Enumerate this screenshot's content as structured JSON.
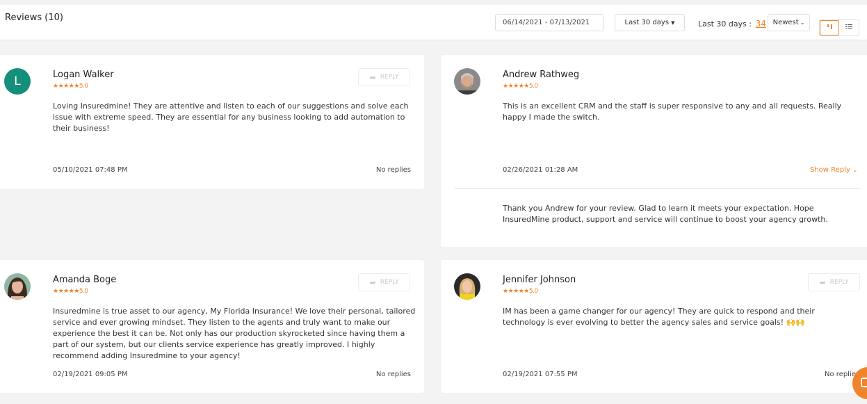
{
  "header": {
    "title": "Reviews (10)",
    "date_range": "06/14/2021 - 07/13/2021",
    "period_dropdown": "Last 30 days",
    "count_label": "Last 30 days :",
    "count_value": "34",
    "sort_dropdown": "Newest"
  },
  "colors": {
    "accent": "#f0842b",
    "avatar_letter_bg": "#148f7a"
  },
  "reviews": [
    {
      "name": "Logan Walker",
      "avatar_letter": "L",
      "rating_label": "5.0",
      "text": "Loving Insuredmine! They are attentive and listen to each of our suggestions and solve each issue with extreme speed. They are essential for any business looking to add automation to their business!",
      "date": "05/10/2021 07:48 PM",
      "status": "No replies",
      "reply_button": "REPLY"
    },
    {
      "name": "Andrew Rathweg",
      "rating_label": "5.0",
      "text": "This is an excellent CRM and the staff is super responsive to any and all requests. Really happy I made the switch.",
      "date": "02/26/2021 01:28 AM",
      "status": "Show Reply",
      "reply_text": "Thank you Andrew for your review. Glad to learn it meets your expectation. Hope InsuredMine product, support and service will continue to boost your agency growth."
    },
    {
      "name": "Amanda Boge",
      "rating_label": "5.0",
      "text": "Insuredmine is true asset to our agency, My Florida Insurance! We love their personal, tailored service and ever growing mindset. They listen to the agents and truly want to make our experience the best it can be. Not only has our production skyrocketed since having them a part of our system, but our clients service experience has greatly improved. I highly recommend adding Insuredmine to your agency!",
      "date": "02/19/2021 09:05 PM",
      "status": "No replies",
      "reply_button": "REPLY"
    },
    {
      "name": "Jennifer Johnson",
      "rating_label": "5.0",
      "text": "IM has been a game changer for our agency! They are quick to respond and their technology is ever evolving to better the agency sales and service goals! 🙌🙌",
      "date": "02/19/2021 07:55 PM",
      "status": "No replies",
      "reply_button": "REPLY"
    }
  ],
  "stars_glyph": "★★★★★",
  "icons": {
    "reply": "reply-arrow-icon",
    "chevron": "chevron-down-icon",
    "grid": "grid-view-icon",
    "list": "list-view-icon",
    "chat": "chat-icon"
  }
}
